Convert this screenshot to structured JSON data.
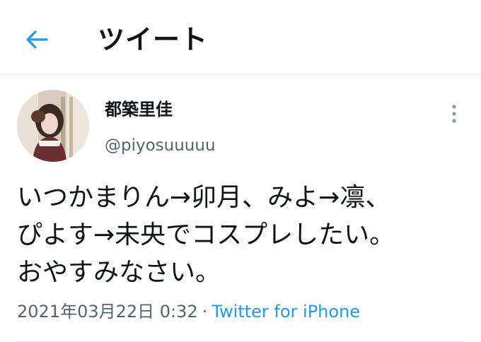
{
  "header": {
    "title": "ツイート",
    "back_icon": "back-arrow-icon"
  },
  "tweet": {
    "author": {
      "display_name": "都築里佳",
      "handle": "@piyosuuuuu"
    },
    "more_icon": "more-vertical-icon",
    "text_lines": [
      "いつかまりん→卯月、みよ→凛、",
      "ぴよす→未央でコスプレしたい。",
      "おやすみなさい。"
    ],
    "timestamp": "2021年03月22日 0:32",
    "separator": "·",
    "source": "Twitter for iPhone"
  },
  "colors": {
    "accent": "#1d9bf0",
    "text_primary": "#0f1419",
    "text_secondary": "#536471",
    "divider": "#dfe4e8"
  }
}
